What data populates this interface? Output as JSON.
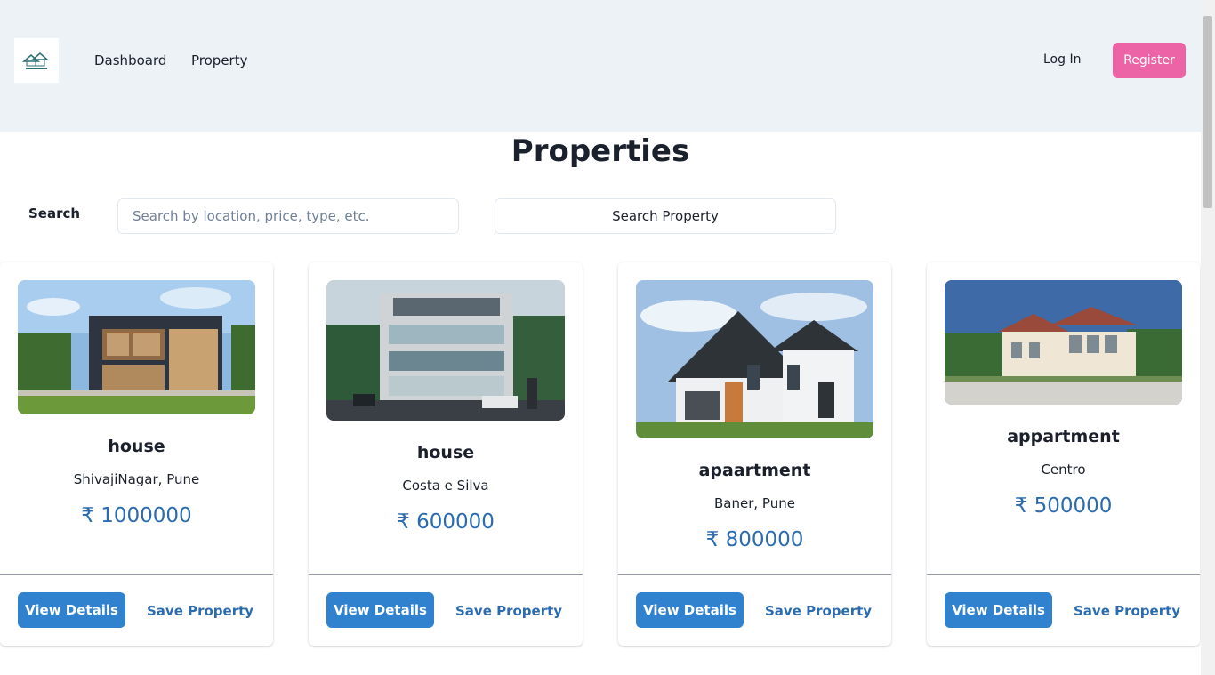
{
  "nav": {
    "logo_alt": "Real Estate",
    "links": [
      "Dashboard",
      "Property"
    ],
    "login_label": "Log In",
    "register_label": "Register"
  },
  "page": {
    "title": "Properties"
  },
  "search": {
    "label": "Search",
    "placeholder": "Search by location, price, type, etc.",
    "value": "",
    "button_label": "Search Property"
  },
  "cards": [
    {
      "title": "house",
      "location": "ShivajiNagar, Pune",
      "price": "₹ 1000000",
      "view_label": "View Details",
      "save_label": "Save Property"
    },
    {
      "title": "house",
      "location": "Costa e Silva",
      "price": "₹ 600000",
      "view_label": "View Details",
      "save_label": "Save Property"
    },
    {
      "title": "apaartment",
      "location": "Baner, Pune",
      "price": "₹ 800000",
      "view_label": "View Details",
      "save_label": "Save Property"
    },
    {
      "title": "appartment",
      "location": "Centro",
      "price": "₹ 500000",
      "view_label": "View Details",
      "save_label": "Save Property"
    }
  ],
  "colors": {
    "header_bg": "#edf2f7",
    "register_bg": "#ed64a6",
    "primary_btn": "#3182ce",
    "price_text": "#2b6cb0"
  }
}
